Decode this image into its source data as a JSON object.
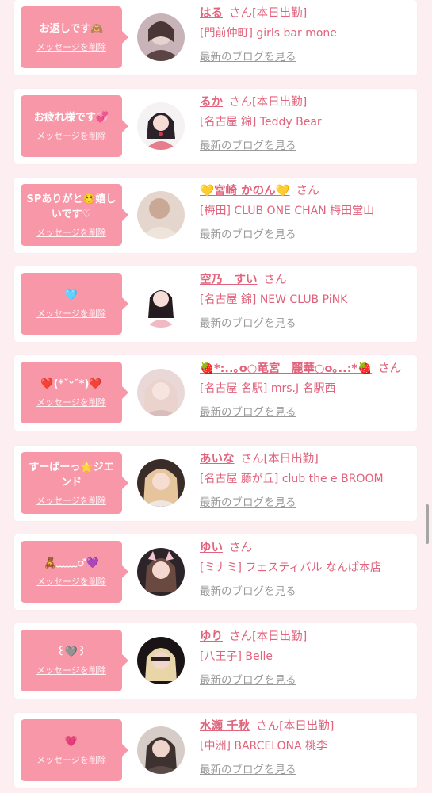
{
  "delete_label": "メッセージを削除",
  "blog_label": "最新のブログを見る",
  "san": "さん",
  "colors": {
    "accent": "#e1637c",
    "bubble": "#f797a8",
    "background": "#fdeef1"
  },
  "items": [
    {
      "message": "お返しです🙈",
      "name": "はる",
      "status": "[本日出勤]",
      "shop": "[門前仲町] girls bar mone"
    },
    {
      "message": "お疲れ様です💞",
      "name": "るか",
      "status": "[本日出勤]",
      "shop": "[名古屋 錦] Teddy Bear"
    },
    {
      "message": "SPありがと☺️嬉しいです♡",
      "name": "💛宮崎 かのん💛",
      "status": "",
      "shop": "[梅田] CLUB ONE CHAN 梅田堂山"
    },
    {
      "message": "🩵",
      "name": "空乃　すい",
      "status": "",
      "shop": "[名古屋 錦] NEW CLUB PiNK"
    },
    {
      "message": "❤️(*˘ᵕ˘*)❤️",
      "name": "🍓*:..｡o○竜宮　麗華○o｡..:*🍓",
      "status": "",
      "shop": "[名古屋 名駅] mrs.J 名駅西"
    },
    {
      "message": "すーぱーっ🌟ジエンド",
      "name": "あいな",
      "status": "[本日出勤]",
      "shop": "[名古屋 藤が丘] club the e BROOM"
    },
    {
      "message": "🧸﹏﹏♂💜",
      "name": "ゆい",
      "status": "",
      "shop": "[ミナミ] フェスティバル なんば本店"
    },
    {
      "message": "꒰🩶꒱",
      "name": "ゆり",
      "status": "[本日出勤]",
      "shop": "[八王子] Belle"
    },
    {
      "message": "💗",
      "name": "水瀬 千秋",
      "status": "[本日出勤]",
      "shop": "[中洲] BARCELONA 桃李"
    }
  ]
}
